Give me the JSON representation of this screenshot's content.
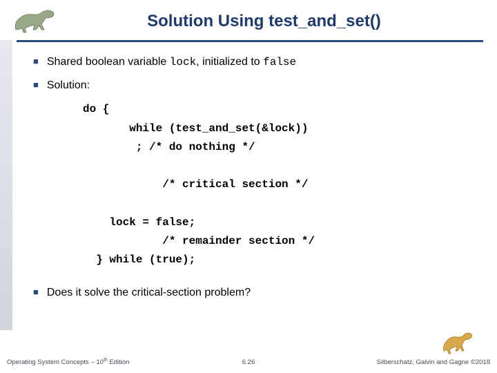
{
  "title": "Solution Using test_and_set()",
  "bullets": {
    "b1_pre": "Shared boolean variable ",
    "b1_code1": "lock",
    "b1_mid": ", initialized to ",
    "b1_code2": "false",
    "b2": "Solution:",
    "b3": "Does it solve the critical-section problem?"
  },
  "code": {
    "l1": "do {",
    "l2": "       while (test_and_set(&lock))",
    "l3": "        ; /* do nothing */",
    "l4": "            /* critical section */",
    "l5": "    lock = false;",
    "l6": "            /* remainder section */",
    "l7": "  } while (true);"
  },
  "footer": {
    "left_pre": "Operating System Concepts – 10",
    "left_sup": "th",
    "left_post": " Edition",
    "center": "6.26",
    "right": "Silberschatz, Galvin and Gagne ©2018"
  }
}
